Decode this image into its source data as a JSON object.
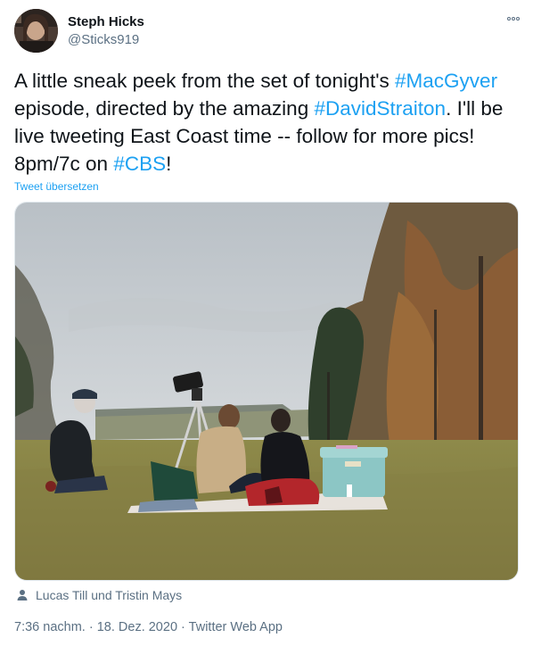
{
  "user": {
    "display_name": "Steph Hicks",
    "handle": "@Sticks919"
  },
  "tweet": {
    "text_parts": [
      {
        "text": "A little sneak peek from the set of tonight's ",
        "hashtag": false
      },
      {
        "text": "#MacGyver",
        "hashtag": true
      },
      {
        "text": " episode, directed by the amazing ",
        "hashtag": false
      },
      {
        "text": "#DavidStraiton",
        "hashtag": true
      },
      {
        "text": ". I'll be live tweeting East Coast time -- follow for more pics! 8pm/7c on ",
        "hashtag": false
      },
      {
        "text": "#CBS",
        "hashtag": true
      },
      {
        "text": "!",
        "hashtag": false
      }
    ],
    "translate_label": "Tweet übersetzen",
    "tagged_people": "Lucas Till und Tristin Mays",
    "time": "7:36 nachm.",
    "separator": "·",
    "date": "18. Dez. 2020",
    "source": "Twitter Web App"
  },
  "icons": {
    "more": "more-options-icon",
    "person": "person-icon"
  },
  "colors": {
    "link": "#1da1f2",
    "secondary_text": "#5b7083",
    "primary_text": "#0f1419"
  }
}
